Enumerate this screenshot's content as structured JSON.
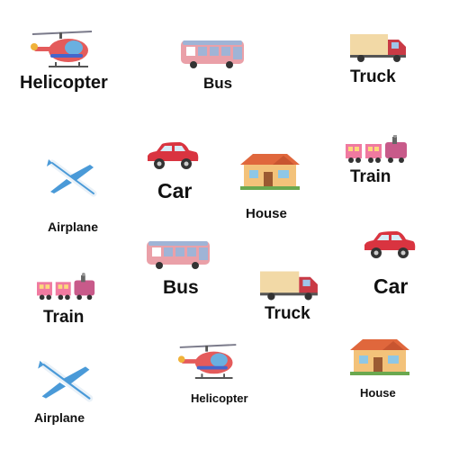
{
  "items": [
    {
      "label": "Helicopter",
      "icon": "helicopter-icon"
    },
    {
      "label": "Bus",
      "icon": "bus-icon"
    },
    {
      "label": "Truck",
      "icon": "truck-icon"
    },
    {
      "label": "Airplane",
      "icon": "airplane-icon"
    },
    {
      "label": "Car",
      "icon": "car-icon"
    },
    {
      "label": "House",
      "icon": "house-icon"
    },
    {
      "label": "Train",
      "icon": "train-icon"
    },
    {
      "label": "Bus",
      "icon": "bus-icon"
    },
    {
      "label": "Car",
      "icon": "car-icon"
    },
    {
      "label": "Train",
      "icon": "train-icon"
    },
    {
      "label": "Truck",
      "icon": "truck-icon"
    },
    {
      "label": "Airplane",
      "icon": "airplane-icon"
    },
    {
      "label": "Helicopter",
      "icon": "helicopter-icon"
    },
    {
      "label": "House",
      "icon": "house-icon"
    }
  ],
  "colors": {
    "car": "#d93440",
    "truck_cargo": "#f2d9a6",
    "truck_cab": "#c93a45",
    "bus_body": "#eaa0a8",
    "bus_windows": "#9fb4d6",
    "house_roof": "#e0673c",
    "house_wall": "#f3c27a",
    "train": "#f07aa0",
    "airplane": "#4a9ad8",
    "helicopter": "#e45b5b"
  }
}
